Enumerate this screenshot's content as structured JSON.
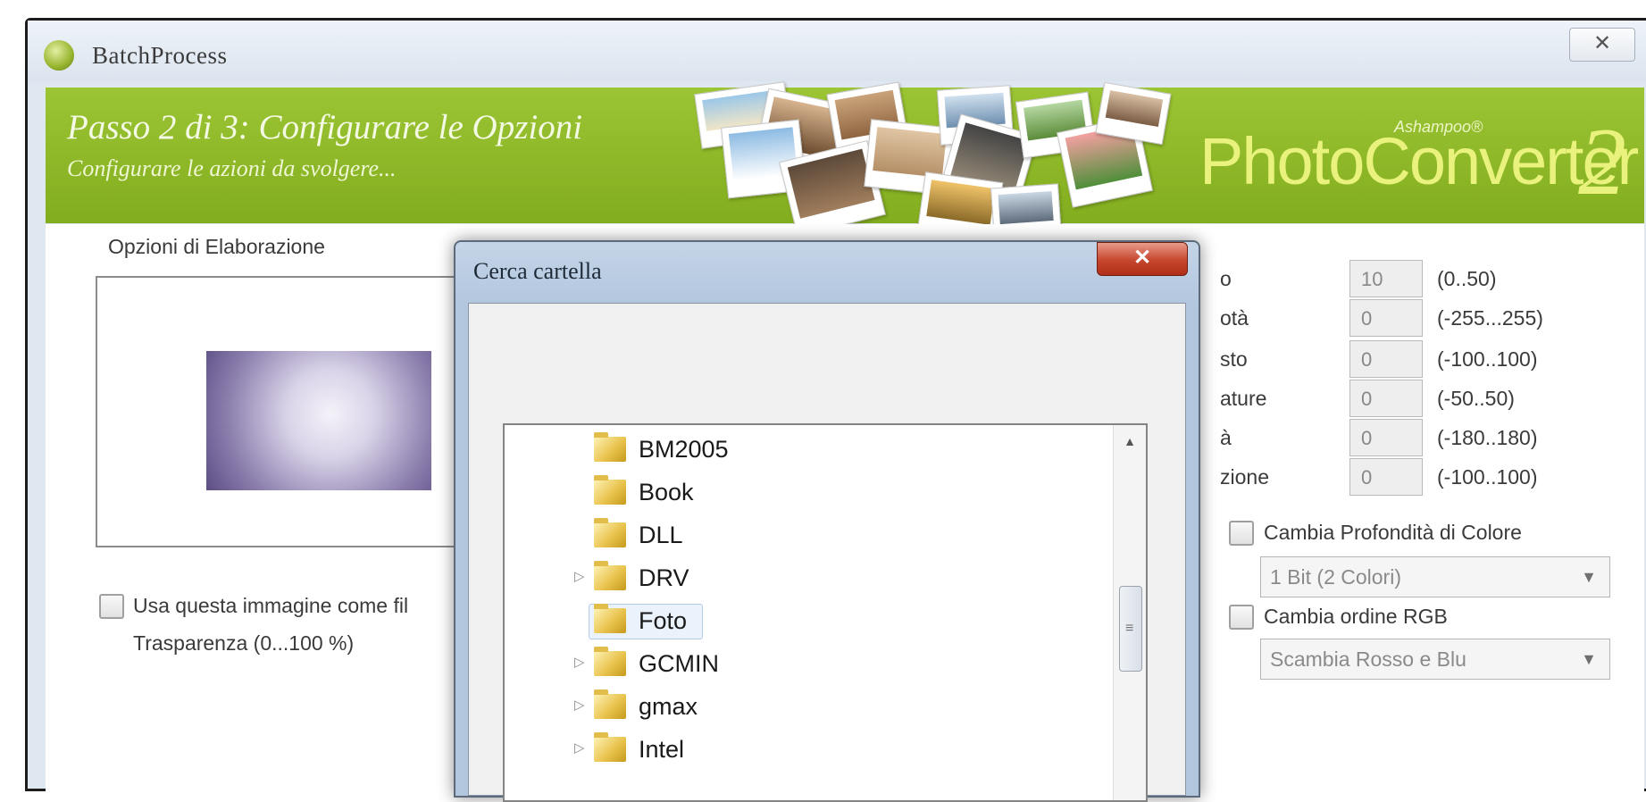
{
  "window": {
    "title": "BatchProcess",
    "close_glyph": "✕"
  },
  "banner": {
    "step_title": "Passo 2 di 3: Configurare le Opzioni",
    "step_subtitle": "Configurare le azioni da svolgere...",
    "brand_vendor": "Ashampoo®",
    "brand_name": "PhotoConverter",
    "brand_version": "2"
  },
  "left_panel": {
    "group_label": "Opzioni di Elaborazione",
    "use_image_checkbox_label": "Usa questa immagine come fil",
    "transparency_label": "Trasparenza (0...100 %)"
  },
  "right_panel": {
    "adjustments": [
      {
        "label_fragment": "o",
        "value": "10",
        "range": "(0..50)"
      },
      {
        "label_fragment": "otà",
        "value": "0",
        "range": "(-255...255)"
      },
      {
        "label_fragment": "sto",
        "value": "0",
        "range": "(-100..100)"
      },
      {
        "label_fragment": "ature",
        "value": "0",
        "range": "(-50..50)"
      },
      {
        "label_fragment": "à",
        "value": "0",
        "range": "(-180..180)"
      },
      {
        "label_fragment": "zione",
        "value": "0",
        "range": "(-100..100)"
      }
    ],
    "color_depth_checkbox_label": "Cambia Profondità di Colore",
    "color_depth_selected": "1 Bit (2 Colori)",
    "rgb_order_checkbox_label": "Cambia ordine RGB",
    "rgb_order_selected": "Scambia Rosso e Blu"
  },
  "dialog": {
    "title": "Cerca cartella",
    "close_glyph": "✕",
    "folders": [
      {
        "name": "BM2005",
        "expandable": false,
        "selected": false
      },
      {
        "name": "Book",
        "expandable": false,
        "selected": false
      },
      {
        "name": "DLL",
        "expandable": false,
        "selected": false
      },
      {
        "name": "DRV",
        "expandable": true,
        "selected": false
      },
      {
        "name": "Foto",
        "expandable": false,
        "selected": true
      },
      {
        "name": "GCMIN",
        "expandable": true,
        "selected": false
      },
      {
        "name": "gmax",
        "expandable": true,
        "selected": false
      },
      {
        "name": "Intel",
        "expandable": true,
        "selected": false
      }
    ]
  },
  "colors": {
    "banner_green": "#8fb926",
    "brand_yellow": "#e9f27c",
    "dialog_close_red": "#c5452d"
  }
}
